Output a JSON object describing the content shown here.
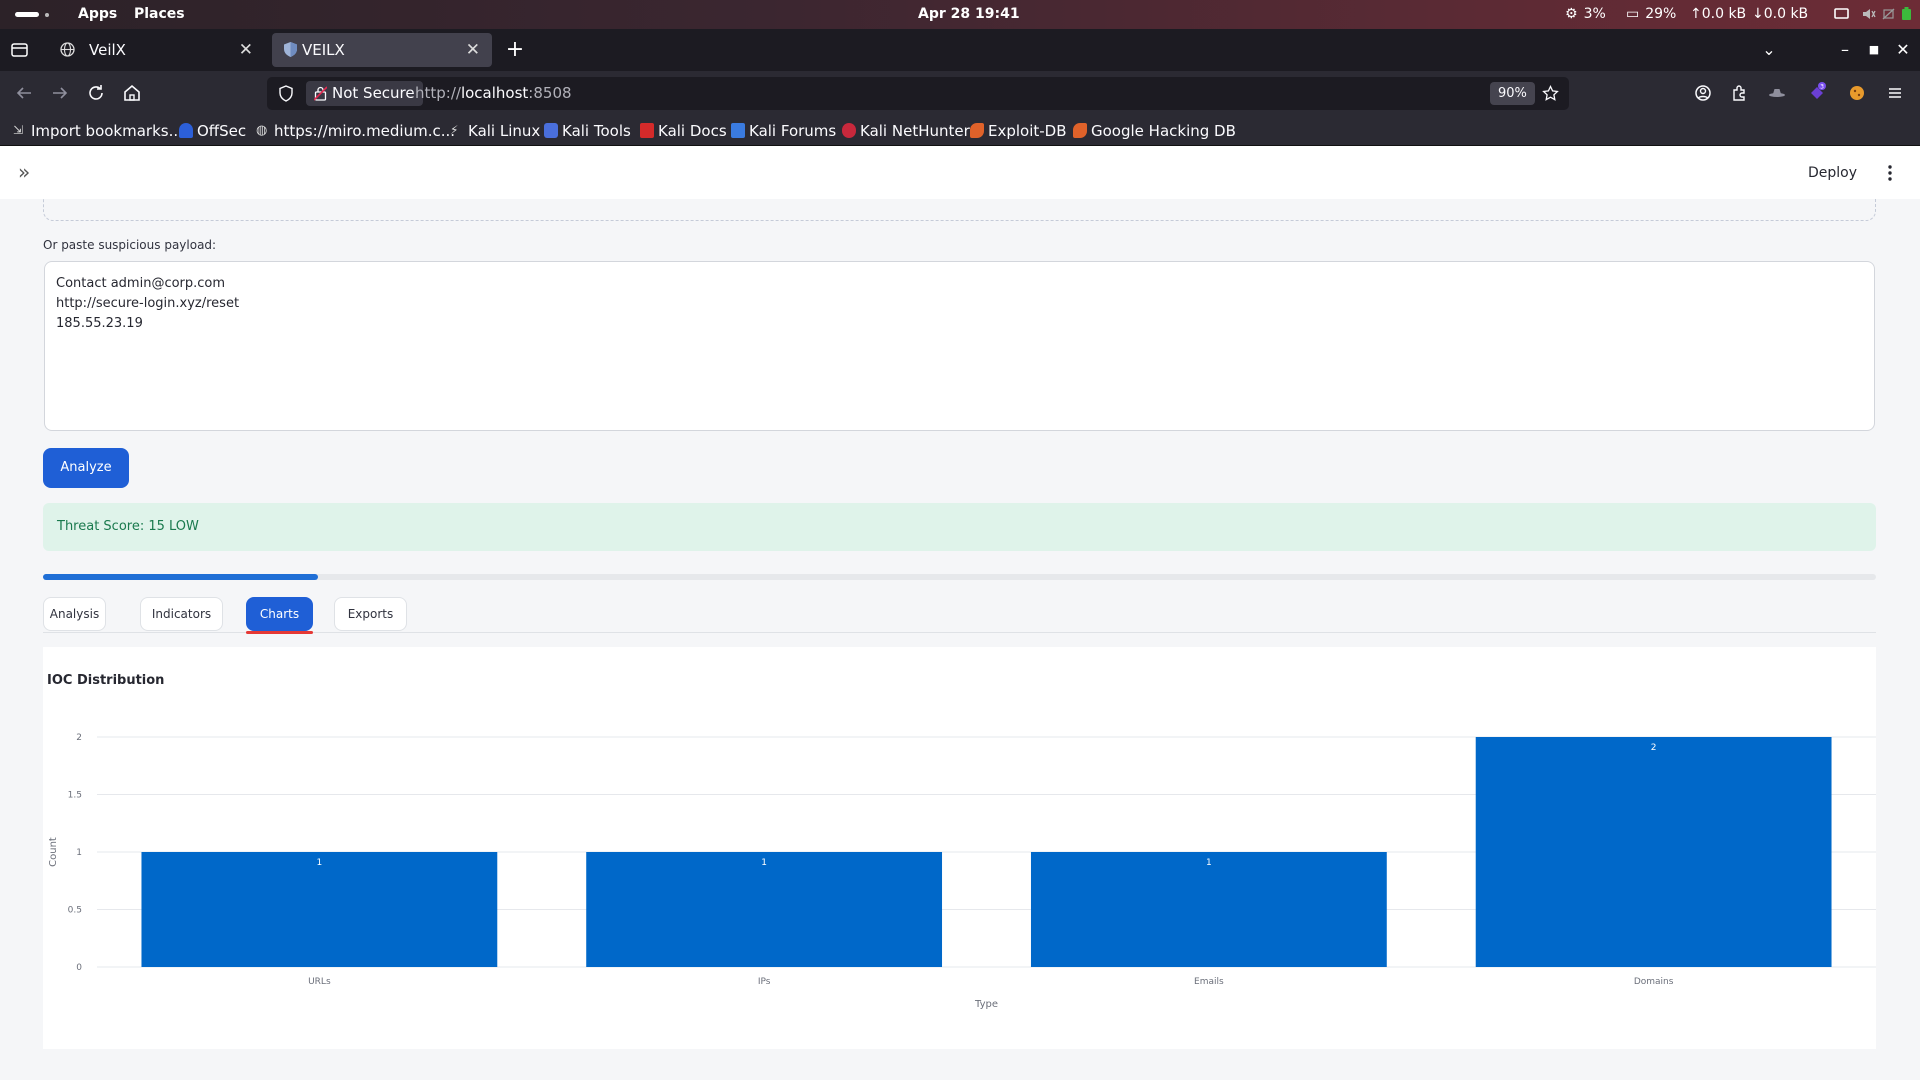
{
  "os": {
    "apps": "Apps",
    "places": "Places",
    "datetime": "Apr 28  19:41",
    "cpu": "3%",
    "memory": "29%",
    "upload": "0.0 kB",
    "download": "0.0 kB"
  },
  "browser": {
    "tabs": [
      {
        "title": "VeilX"
      },
      {
        "title": "VEILX"
      }
    ],
    "security_label": "Not Secure",
    "url_prefix": "http://",
    "url_host": "localhost",
    "url_port": ":8508",
    "zoom": "90%",
    "bookmarks": [
      "Import bookmarks...",
      "OffSec",
      "https://miro.medium.c...",
      "Kali Linux",
      "Kali Tools",
      "Kali Docs",
      "Kali Forums",
      "Kali NetHunter",
      "Exploit-DB",
      "Google Hacking DB"
    ]
  },
  "app": {
    "deploy": "Deploy",
    "payload_label": "Or paste suspicious payload:",
    "payload_value": "Contact admin@corp.com\nhttp://secure-login.xyz/reset\n185.55.23.19",
    "analyze": "Analyze",
    "threat": "Threat Score: 15 LOW",
    "progress": 0.15,
    "tabs": [
      "Analysis",
      "Indicators",
      "Charts",
      "Exports"
    ],
    "active_tab": "Charts"
  },
  "colors": {
    "accent": "#1f5fd6",
    "bar": "#0068c9",
    "success_bg": "#dff3ea",
    "success_text": "#1a7a4e"
  },
  "chart_data": {
    "type": "bar",
    "title": "IOC Distribution",
    "xlabel": "Type",
    "ylabel": "Count",
    "categories": [
      "URLs",
      "IPs",
      "Emails",
      "Domains"
    ],
    "values": [
      1,
      1,
      1,
      2
    ],
    "ylim": [
      0,
      2
    ],
    "yticks": [
      "0",
      "0.5",
      "1",
      "1.5",
      "2"
    ],
    "grid": true
  }
}
